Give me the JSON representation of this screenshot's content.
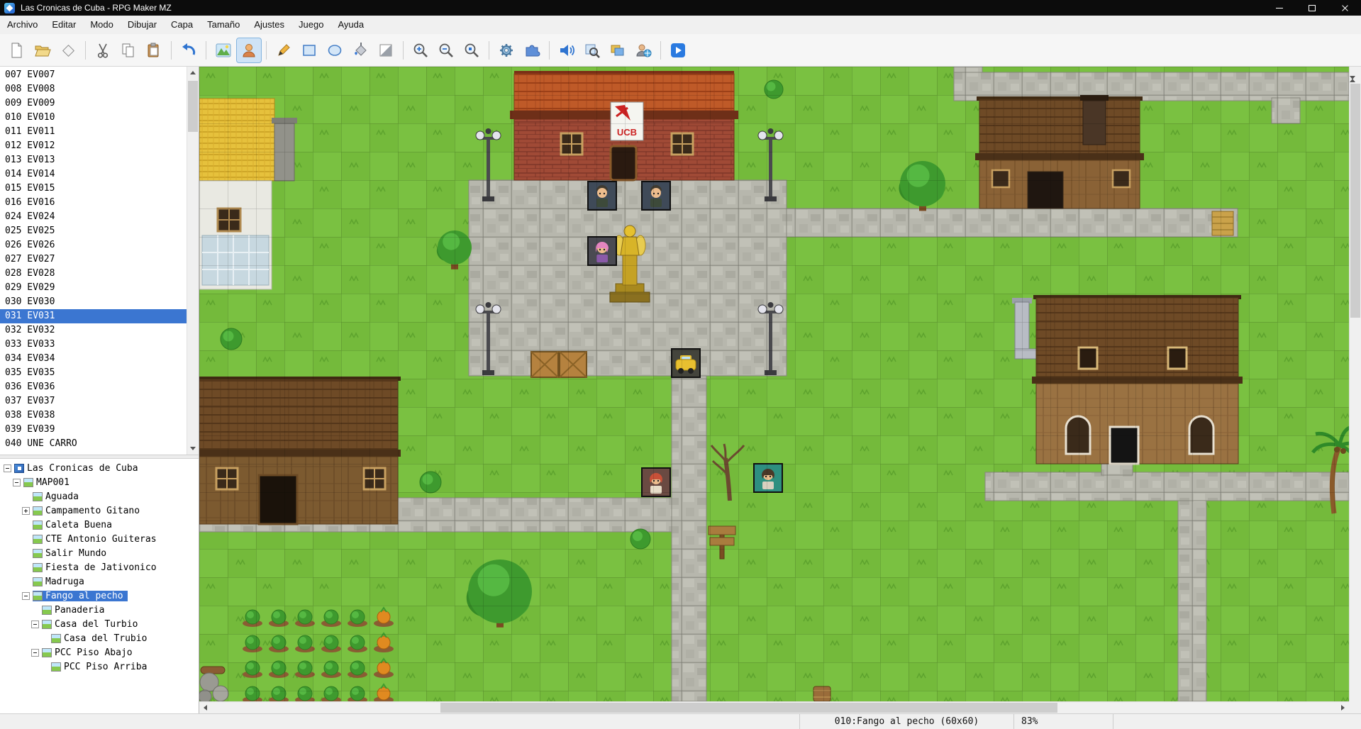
{
  "window": {
    "title": "Las Cronicas de Cuba - RPG Maker MZ"
  },
  "menu_bar": {
    "items": [
      "Archivo",
      "Editar",
      "Modo",
      "Dibujar",
      "Capa",
      "Tamaño",
      "Ajustes",
      "Juego",
      "Ayuda"
    ]
  },
  "toolbar": {
    "buttons": [
      "new-project",
      "open-project",
      "save-project",
      "cut",
      "copy",
      "paste",
      "undo",
      "map-mode",
      "event-mode",
      "pen-tool",
      "rectangle-tool",
      "ellipse-tool",
      "flood-fill-tool",
      "shadow-pen-tool",
      "zoom-in",
      "zoom-out",
      "zoom-actual",
      "database",
      "plugin-manager",
      "sound-test",
      "event-searcher",
      "resource-manager",
      "character-generator",
      "play-test"
    ],
    "active": "event-mode"
  },
  "event_list": {
    "items": [
      "007 EV007",
      "008 EV008",
      "009 EV009",
      "010 EV010",
      "011 EV011",
      "012 EV012",
      "013 EV013",
      "014 EV014",
      "015 EV015",
      "016 EV016",
      "024 EV024",
      "025 EV025",
      "026 EV026",
      "027 EV027",
      "028 EV028",
      "029 EV029",
      "030 EV030",
      "031 EV031",
      "032 EV032",
      "033 EV033",
      "034 EV034",
      "035 EV035",
      "036 EV036",
      "037 EV037",
      "038 EV038",
      "039 EV039",
      "040 UNE CARRO"
    ],
    "selected_index": 17
  },
  "map_tree": {
    "items": [
      {
        "label": "Las Cronicas de Cuba",
        "depth": 0,
        "expander": "minus",
        "icon": "game",
        "selected": false
      },
      {
        "label": "MAP001",
        "depth": 1,
        "expander": "minus",
        "icon": "map",
        "selected": false
      },
      {
        "label": "Aguada",
        "depth": 2,
        "expander": null,
        "icon": "map",
        "selected": false
      },
      {
        "label": "Campamento Gitano",
        "depth": 2,
        "expander": "plus",
        "icon": "map",
        "selected": false
      },
      {
        "label": "Caleta Buena",
        "depth": 2,
        "expander": null,
        "icon": "map",
        "selected": false
      },
      {
        "label": "CTE Antonio Guiteras",
        "depth": 2,
        "expander": null,
        "icon": "map",
        "selected": false
      },
      {
        "label": "Salir Mundo",
        "depth": 2,
        "expander": null,
        "icon": "map",
        "selected": false
      },
      {
        "label": "Fiesta de Jativonico",
        "depth": 2,
        "expander": null,
        "icon": "map",
        "selected": false
      },
      {
        "label": "Madruga",
        "depth": 2,
        "expander": null,
        "icon": "map",
        "selected": false
      },
      {
        "label": "Fango al pecho",
        "depth": 2,
        "expander": "minus",
        "icon": "map",
        "selected": true
      },
      {
        "label": "Panaderia",
        "depth": 3,
        "expander": null,
        "icon": "map",
        "selected": false
      },
      {
        "label": "Casa del Turbio",
        "depth": 3,
        "expander": "minus",
        "icon": "map",
        "selected": false
      },
      {
        "label": "Casa del Trubio",
        "depth": 4,
        "expander": null,
        "icon": "map",
        "selected": false
      },
      {
        "label": "PCC Piso Abajo",
        "depth": 3,
        "expander": "minus",
        "icon": "map",
        "selected": false
      },
      {
        "label": "PCC Piso Arriba",
        "depth": 4,
        "expander": null,
        "icon": "map",
        "selected": false
      }
    ]
  },
  "status_bar": {
    "map_info": "010:Fango al pecho (60x60)",
    "zoom": "83%"
  },
  "map_view": {
    "sign_text": "UCB"
  }
}
